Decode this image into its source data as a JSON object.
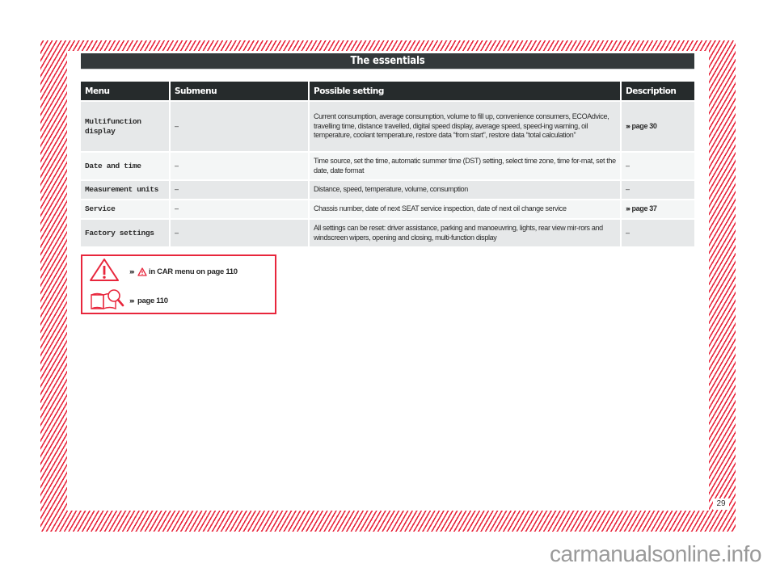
{
  "page": {
    "title": "The essentials",
    "page_number": "29",
    "watermark": "carmanualsonline.info",
    "accent_color": "#e8263c",
    "header_color": "#262b2c"
  },
  "table": {
    "columns": [
      "Menu",
      "Submenu",
      "Possible setting",
      "Description"
    ],
    "rows": [
      {
        "menu": "Multifunction display",
        "submenu": "–",
        "setting": "Current consumption, average consumption, volume to fill up, convenience consumers, ECOAdvice, travelling time, distance travelled, digital speed display, average speed, speed-ing warning, oil temperature, coolant temperature, restore data “from start”, restore data “total calculation”",
        "description": "page 30",
        "description_is_link": true
      },
      {
        "menu": "Date and time",
        "submenu": "–",
        "setting": "Time source, set the time, automatic summer time (DST) setting, select time zone, time for-mat, set the date, date format",
        "description": "–",
        "description_is_link": false
      },
      {
        "menu": "Measurement units",
        "submenu": "–",
        "setting": "Distance, speed, temperature, volume, consumption",
        "description": "–",
        "description_is_link": false
      },
      {
        "menu": "Service",
        "submenu": "–",
        "setting": "Chassis number, date of next SEAT service inspection, date of next oil change service",
        "description": "page 37",
        "description_is_link": true
      },
      {
        "menu": "Factory settings",
        "submenu": "–",
        "setting": "All settings can be reset: driver assistance, parking and manoeuvring, lights, rear view mir-rors and windscreen wipers, opening and closing, multi-function display",
        "description": "–",
        "description_is_link": false
      }
    ]
  },
  "notice": {
    "chevron": "›››",
    "warning_text": "in CAR menu on page 110",
    "warning_icon": "warning-triangle-icon",
    "reference_text": "page 110",
    "reference_icon": "book-magnifier-icon"
  }
}
